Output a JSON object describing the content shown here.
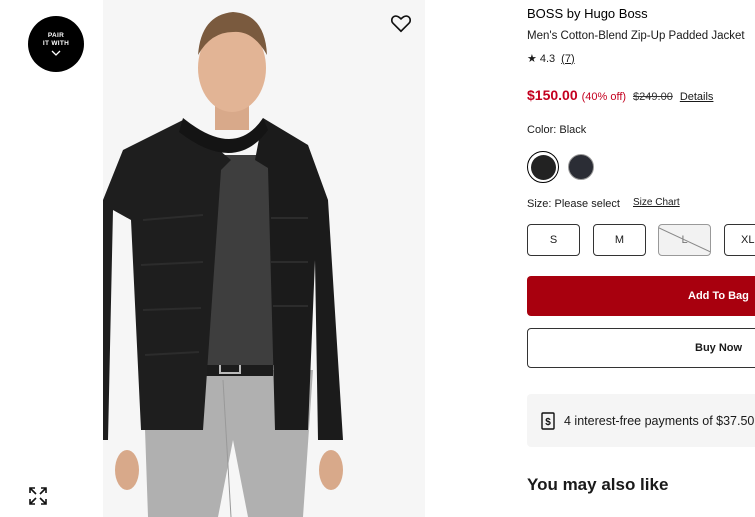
{
  "gallery": {
    "pair_badge": {
      "line1": "PAIR",
      "line2": "IT WITH"
    }
  },
  "product": {
    "brand": "BOSS by Hugo Boss",
    "name": "Men's Cotton-Blend Zip-Up Padded Jacket",
    "rating": "4.3",
    "review_count": "(7)",
    "sale_price": "$150.00",
    "discount": "(40% off)",
    "original_price": "$249.00",
    "details_link": "Details"
  },
  "color": {
    "label": "Color: Black",
    "swatches": [
      {
        "name": "Black",
        "hex": "#222222",
        "selected": true
      },
      {
        "name": "Navy",
        "hex": "#2b2d35",
        "selected": false
      }
    ]
  },
  "size": {
    "label": "Size: Please select",
    "chart_link": "Size Chart",
    "options": [
      {
        "label": "S",
        "available": true
      },
      {
        "label": "M",
        "available": true
      },
      {
        "label": "L",
        "available": false
      },
      {
        "label": "XL",
        "available": true
      }
    ]
  },
  "actions": {
    "add_to_bag": "Add To Bag",
    "buy_now": "Buy Now"
  },
  "payments": {
    "text": "4 interest-free payments of $37.50"
  },
  "recommendations": {
    "heading": "You may also like"
  },
  "colors": {
    "sale_red": "#c4001f",
    "add_to_bag_bg": "#a8000e"
  }
}
